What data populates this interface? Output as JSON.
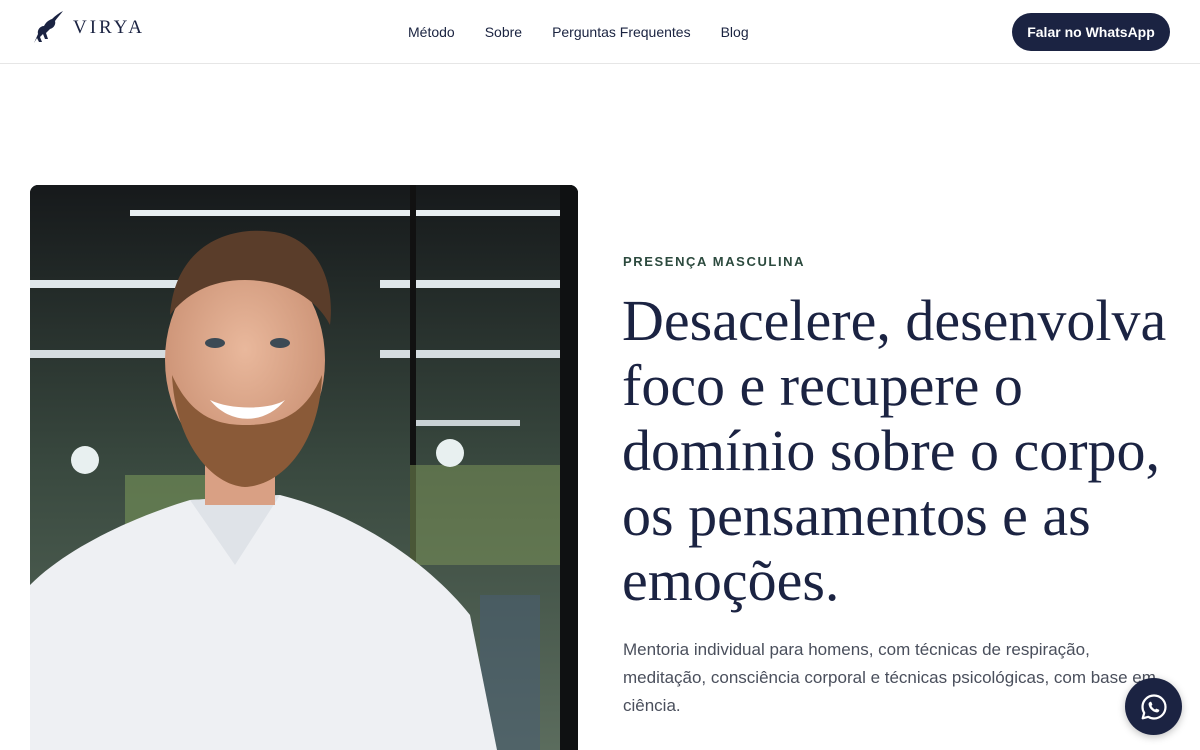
{
  "brand": {
    "name": "VIRYA",
    "logo_icon": "monkey-silhouette-icon"
  },
  "nav": {
    "items": [
      {
        "label": "Método"
      },
      {
        "label": "Sobre"
      },
      {
        "label": "Perguntas Frequentes"
      },
      {
        "label": "Blog"
      }
    ],
    "cta_label": "Falar no WhatsApp"
  },
  "hero": {
    "eyebrow": "PRESENÇA MASCULINA",
    "headline": "Desacelere, desenvolva foco e recupere o domínio sobre o corpo, os pensamentos e as emoções.",
    "subtitle": "Mentoria individual para homens, com técnicas de respiração, meditação, consciência corporal e técnicas psicológicas, com base em ciência.",
    "photo_icon": "portrait-photo"
  },
  "floating": {
    "icon": "whatsapp-icon"
  },
  "colors": {
    "primary": "#1b2342",
    "eyebrow": "#2c4a3e",
    "body_text": "#4a4f5c"
  }
}
